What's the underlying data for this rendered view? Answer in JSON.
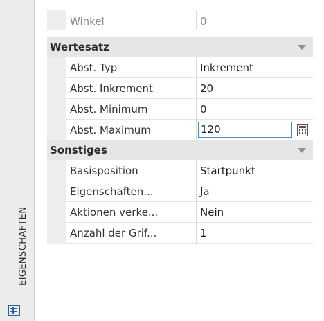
{
  "sidebar": {
    "title": "EIGENSCHAFTEN"
  },
  "top_row": {
    "label": "Winkel",
    "value": "0"
  },
  "categories": [
    {
      "title": "Wertesatz",
      "rows": [
        {
          "label": "Abst. Typ",
          "value": "Inkrement"
        },
        {
          "label": "Abst. Inkrement",
          "value": "20"
        },
        {
          "label": "Abst. Minimum",
          "value": "0"
        },
        {
          "label": "Abst. Maximum",
          "value": "120"
        }
      ]
    },
    {
      "title": "Sonstiges",
      "rows": [
        {
          "label": "Basisposition",
          "value": "Startpunkt"
        },
        {
          "label": "Eigenschaften...",
          "value": "Ja"
        },
        {
          "label": "Aktionen verke...",
          "value": "Nein"
        },
        {
          "label": "Anzahl der Grif...",
          "value": "1"
        }
      ]
    }
  ],
  "icons": {
    "sidebar": "properties-palette-icon",
    "calculator": "calculator-icon",
    "collapse": "chevron-down-icon"
  },
  "colors": {
    "accent": "#3c8fd6",
    "category_bg": "#e6e6e6",
    "sidebar_bg": "#ececec"
  }
}
